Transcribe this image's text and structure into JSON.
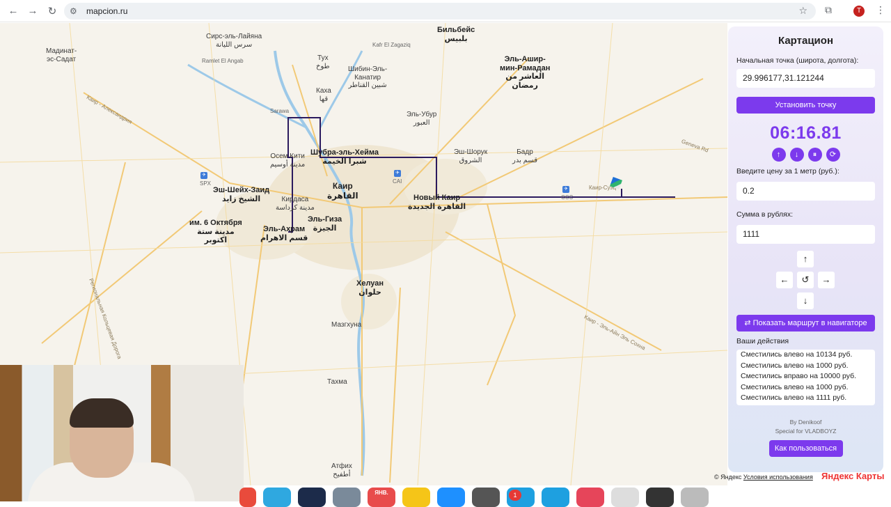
{
  "browser": {
    "url": "mapcion.ru",
    "back_icon": "←",
    "forward_icon": "→",
    "reload_icon": "↻",
    "profile_initial": "T"
  },
  "map": {
    "labels": {
      "bilbeis": "Бильбейс\nبلبيس",
      "sirs": "Сирс-эль-Лайяна\nسرس الليانة",
      "madinat": "Мадинат-\nэс-Садат",
      "ramlet": "Ramlet El Angab",
      "tukh": "Тух\nطوخ",
      "kafr": "Kafr El Zagaziq",
      "ashir": "Эль-Ашир-\nмин-Рамадан\nالعاشر من\nرمضان",
      "shibin": "Шибин-Эль-\nКанатир\nشبين القناطر",
      "qaha": "Каха\nقها",
      "ubur": "Эль-Убур\nالعبور",
      "sarawa": "Sarawa",
      "shorouk": "Эш-Шорук\nالشروق",
      "badr": "Бадр\nقسم بدر",
      "shubra": "Шубра-эль-Хейма\nشبرا الخيمة",
      "osem": "Осем Кити\nمدينة أوسيم",
      "sheikh": "Эш-Шейх-Заид\nالشيخ زايد",
      "cairo": "Каир\nالقاهرة",
      "kirdasa": "Кирдаса\nمدينة كرداسة",
      "new_cairo": "Новый Каир\nالقاهرة الجديدة",
      "october": "им. 6 Октября\nمدينة ستة\nاكتوبر",
      "ahram": "Эль-Ахрам\nقسم الاهرام",
      "giza": "Эль-Гиза\nالجيزة",
      "helwan": "Хелуан\nحلوان",
      "mazghuna": "Мазгхуна",
      "tahma": "Тахма",
      "atfih": "Атфих\nأطفيح",
      "spx": "SPX",
      "cai": "CAI",
      "ccc": "CCC",
      "kair_suez": "Каир-Суэц",
      "kair_alex": "Каир - Александрия",
      "geneva": "Geneva Rd",
      "ring": "Региональная Кольцевая Дорога",
      "kair_ain": "Каир - Эль-Айн Эль Сохна"
    },
    "copyright": "© Яндекс",
    "terms": "Условия использования",
    "logo": "Яндекс Карты",
    "route_color": "#2b1a5e"
  },
  "panel": {
    "title": "Картацион",
    "start_label": "Начальная точка (широта, долгота):",
    "start_value": "29.996177,31.121244",
    "set_point_button": "Установить точку",
    "timer": "06:16.81",
    "timer_controls": [
      "↑",
      "↓",
      "⏸",
      "⟳"
    ],
    "price_label": "Введите цену за 1 метр (руб.):",
    "price_value": "0.2",
    "sum_label": "Сумма в рублях:",
    "sum_value": "1111",
    "dpad": {
      "up": "↑",
      "left": "←",
      "reset": "↺",
      "right": "→",
      "down": "↓"
    },
    "navigator_button": "Показать маршрут в навигаторе",
    "actions_label": "Ваши действия",
    "actions": [
      "Сместились влево на 10134 руб.",
      "Сместились влево на 1000 руб.",
      "Сместились вправо на 10000 руб.",
      "Сместились влево на 1000 руб.",
      "Сместились влево на 1111 руб."
    ],
    "credit_by": "By Denikoof",
    "credit_special": "Special for VLADBOYZ",
    "howto_button": "Как пользоваться"
  },
  "dock": {
    "calendar_label": "ЯНВ.",
    "badge_count": "1"
  }
}
